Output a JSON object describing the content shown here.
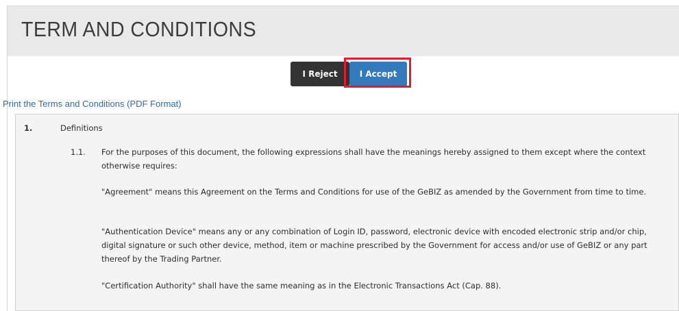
{
  "header": {
    "title": "TERM AND CONDITIONS"
  },
  "actions": {
    "reject_label": "I Reject",
    "accept_label": "I Accept"
  },
  "print_link": "Print the Terms and Conditions (PDF Format)",
  "terms": {
    "section_number": "1.",
    "section_title": "Definitions",
    "clause_number": "1.1.",
    "clause_text": "For the purposes of this document, the following expressions shall have the meanings hereby assigned to them except where the context otherwise requires:",
    "definitions": [
      "\"Agreement\" means this Agreement on the Terms and Conditions for use of the GeBIZ as amended by the Government from time to time.",
      "\"Authentication Device\" means any or any combination of Login ID, password, electronic device with encoded electronic strip and/or chip, digital signature or such other device, method, item or machine prescribed by the Government for access and/or use of GeBIZ or any part thereof by the Trading Partner.",
      "\"Certification Authority\" shall have the same meaning as in the Electronic Transactions Act (Cap. 88)."
    ]
  },
  "colors": {
    "accept_button": "#3579bd",
    "reject_button": "#333333",
    "highlight_border": "#e8192c",
    "link": "#2e6da4"
  }
}
